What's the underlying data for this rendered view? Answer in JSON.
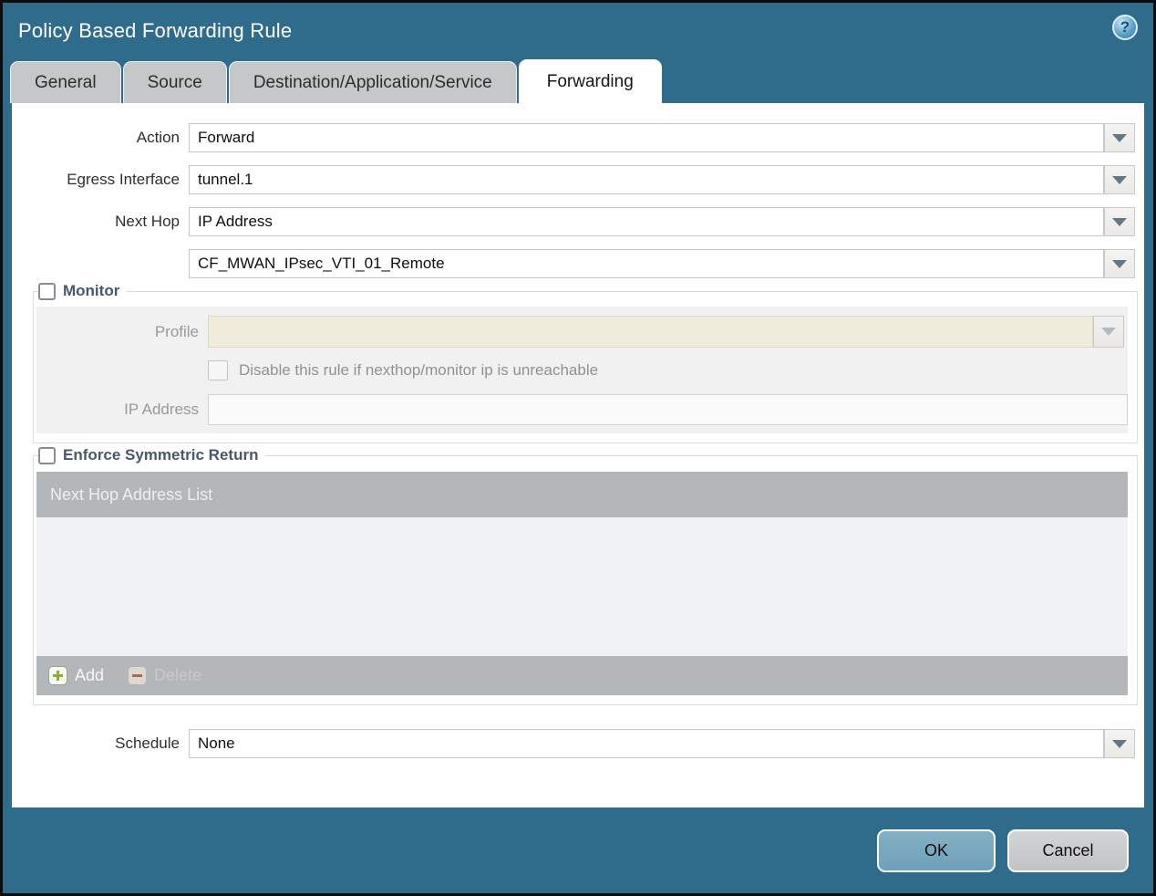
{
  "window": {
    "title": "Policy Based Forwarding Rule"
  },
  "help_icon": "?",
  "tabs": {
    "general": "General",
    "source": "Source",
    "destination": "Destination/Application/Service",
    "forwarding": "Forwarding"
  },
  "form": {
    "action": {
      "label": "Action",
      "value": "Forward"
    },
    "egress_interface": {
      "label": "Egress Interface",
      "value": "tunnel.1"
    },
    "next_hop": {
      "label": "Next Hop",
      "value": "IP Address"
    },
    "next_hop_address": {
      "value": "CF_MWAN_IPsec_VTI_01_Remote"
    },
    "schedule": {
      "label": "Schedule",
      "value": "None"
    }
  },
  "monitor": {
    "legend": "Monitor",
    "checked": false,
    "profile": {
      "label": "Profile",
      "value": ""
    },
    "disable_rule_label": "Disable this rule if nexthop/monitor ip is unreachable",
    "disable_rule_checked": false,
    "ip_address": {
      "label": "IP Address",
      "value": ""
    }
  },
  "symmetric_return": {
    "legend": "Enforce Symmetric Return",
    "checked": false,
    "table_header": "Next Hop Address List",
    "rows": [],
    "add_label": "Add",
    "delete_label": "Delete"
  },
  "footer": {
    "ok": "OK",
    "cancel": "Cancel"
  },
  "colors": {
    "titlebar_teal": "#2f6b8b",
    "inactive_tab_gray": "#c6c7c8",
    "disabled_field_cream": "#f0ecdc",
    "table_bar_gray": "#b3b7b9",
    "table_body_gray": "#f0f2f3",
    "ok_button_blue": "#74a5bc",
    "cancel_button_gray": "#c9cacc",
    "legend_text": "#46586d",
    "add_icon_green": "#8bae3d",
    "delete_icon_red": "#a96a52"
  }
}
